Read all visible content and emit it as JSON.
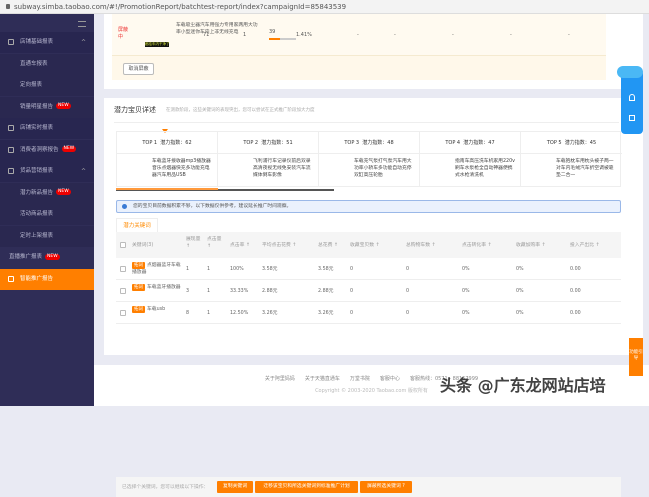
{
  "url": "subway.simba.taobao.com/#!/PromotionReport/batchtest-report/index?campaignId=85843539",
  "sidebar": {
    "items": [
      {
        "label": "店铺基础报表",
        "type": "group",
        "expanded": true
      },
      {
        "label": "直通车报表",
        "type": "sub"
      },
      {
        "label": "定向报表",
        "type": "sub"
      },
      {
        "label": "销量明星报告",
        "type": "sub",
        "badge": "NEW"
      },
      {
        "label": "店铺实时报表",
        "type": "group"
      },
      {
        "label": "消费者洞察报告",
        "type": "group",
        "badge": "NEW"
      },
      {
        "label": "货品营销报表",
        "type": "group",
        "expanded": true
      },
      {
        "label": "潜力新品报告",
        "type": "sub",
        "badge": "NEW"
      },
      {
        "label": "活动商品报表",
        "type": "sub"
      },
      {
        "label": "定时上架报表",
        "type": "sub"
      },
      {
        "label": "直播推广报表",
        "type": "top",
        "badge": "NEW"
      },
      {
        "label": "智能推广报告",
        "type": "group",
        "active": true
      }
    ]
  },
  "blocked": {
    "status": "屏蔽中",
    "title": "车载吸尘器汽车用强力专用家两用大功率小型迷你车内上非无线充电",
    "thumb_text": "都给车内干净了",
    "score": 39,
    "score_pct": 39,
    "cols": [
      "71",
      "1",
      "1.41%",
      "-",
      "-",
      "-",
      "-",
      "-"
    ],
    "unblock_label": "取消屏蔽"
  },
  "potential": {
    "title": "潜力宝贝详述",
    "hint": "在测款阶段，这些关键词的表现突出，您可以尝试在正式推广阶段加大力度",
    "tops": [
      {
        "rank": "TOP 1",
        "index_label": "潜力指数：62",
        "desc": "车载蓝牙接收器mp3播放器音乐点烟器快充多功能充电器汽车用品USB"
      },
      {
        "rank": "TOP 2",
        "index_label": "潜力指数：51",
        "desc": "飞利浦行车记录仪前后双录高清夜视无线免安装汽车流媒体倒车影像"
      },
      {
        "rank": "TOP 3",
        "index_label": "潜力指数：48",
        "desc": "车载充气泵打气泵汽车用大功率小轿车多功能自动充停双缸高压轮胎"
      },
      {
        "rank": "TOP 4",
        "index_label": "潜力指数：47",
        "desc": "指南车高压洗车机家用220v刷车水泵枪全自动神器便携式水枪清洗机"
      },
      {
        "rank": "TOP 5",
        "index_label": "潜力指数：45",
        "desc": "车载抱枕车用枕头被子两一对车内毛绒汽车折空调被靠垫二合一"
      }
    ],
    "notice": "您的宝贝目前数据积累不够，以下数据仅供参考，建议延长推广时间观察。",
    "tab": "潜力关键词",
    "headers": [
      "关键词(3)",
      "展现量 ↑",
      "点击量 ↑",
      "点击率 ↑",
      "平均点击花费 ↑",
      "总花费 ↑",
      "收藏宝贝数 ↑",
      "总购物车数 ↑",
      "点击转化率 ↑",
      "收藏加购率 ↑",
      "投入产出比 ↑"
    ],
    "rows": [
      {
        "tag": "拓词",
        "keyword": "点烟器蓝牙车载播放器",
        "cells": [
          "1",
          "1",
          "100%",
          "3.58元",
          "3.58元",
          "0",
          "0",
          "0%",
          "0%",
          "0.00"
        ]
      },
      {
        "tag": "拓词",
        "keyword": "车载蓝牙播放器",
        "cells": [
          "3",
          "1",
          "33.33%",
          "2.88元",
          "2.88元",
          "0",
          "0",
          "0%",
          "0%",
          "0.00"
        ]
      },
      {
        "tag": "拓词",
        "keyword": "车载usb",
        "cells": [
          "8",
          "1",
          "12.50%",
          "3.26元",
          "3.26元",
          "0",
          "0",
          "0%",
          "0%",
          "0.00"
        ]
      }
    ],
    "footer_hint": "已选择个关键词，您可以继续以下操作：",
    "actions": [
      "复制关键词",
      "迁移该宝贝和所选关键词到标准推广计划",
      "屏蔽所选关键词"
    ]
  },
  "footer": {
    "links": [
      "关于阿里妈妈",
      "关于天猫直通车",
      "万堂书院",
      "客服中心",
      "客服热线：0571 - 88157999"
    ],
    "copyright": "Copyright © 2003-2020 Taobao.com 版权所有"
  },
  "float": {
    "guide": "功能引导"
  },
  "watermark": "头条 @广东龙网站店培"
}
